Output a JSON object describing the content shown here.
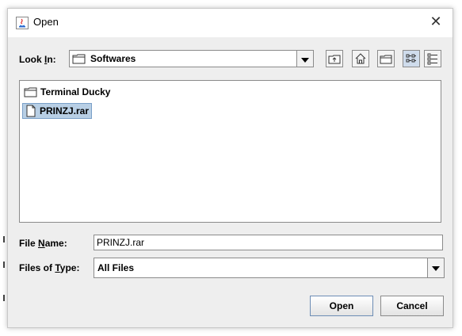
{
  "window": {
    "title": "Open",
    "close_glyph": "✕"
  },
  "look_in": {
    "label_pre": "Look ",
    "label_u": "I",
    "label_post": "n:",
    "value": "Softwares",
    "icon": "folder-icon"
  },
  "toolbar": {
    "buttons": [
      {
        "name": "up-one-level-button",
        "icon": "folder-up-icon"
      },
      {
        "name": "home-button",
        "icon": "home-icon"
      },
      {
        "name": "new-folder-button",
        "icon": "new-folder-icon"
      },
      {
        "name": "list-view-button",
        "icon": "list-view-icon",
        "active": true
      },
      {
        "name": "details-view-button",
        "icon": "details-view-icon"
      }
    ]
  },
  "files": [
    {
      "name": "Terminal Ducky",
      "type": "folder",
      "icon": "folder-icon",
      "selected": false
    },
    {
      "name": "PRINZJ.rar",
      "type": "file",
      "icon": "file-icon",
      "selected": true
    }
  ],
  "file_name": {
    "label_pre": "File ",
    "label_u": "N",
    "label_post": "ame:",
    "value": "PRINZJ.rar"
  },
  "file_type": {
    "label_pre": "Files of ",
    "label_u": "T",
    "label_post": "ype:",
    "value": "All Files"
  },
  "buttons": {
    "open": "Open",
    "cancel": "Cancel"
  },
  "colors": {
    "selection": "#b8cfe5",
    "dialog_bg": "#eeeeee"
  }
}
